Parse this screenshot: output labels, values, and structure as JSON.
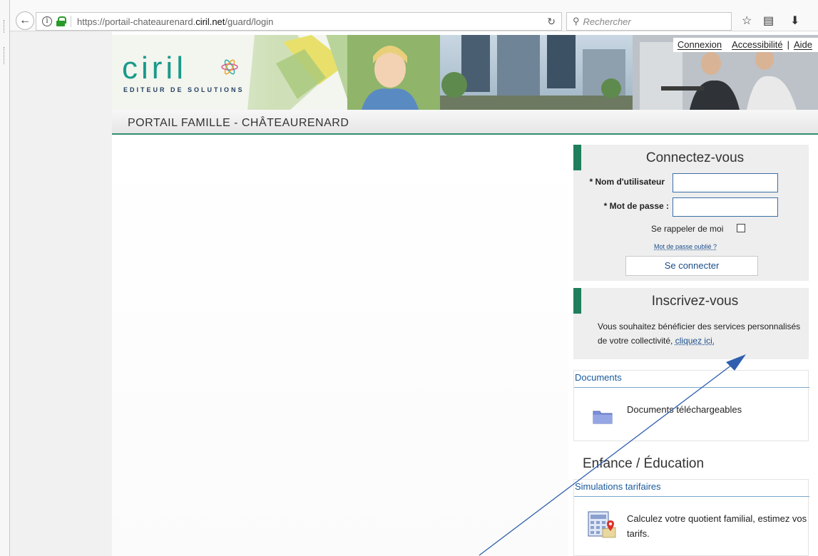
{
  "browser": {
    "url_prefix": "https://portail-chateaurenard.",
    "url_domain": "ciril.net",
    "url_suffix": "/guard/login",
    "search_placeholder": "Rechercher",
    "icons": [
      "back-arrow-icon",
      "info-icon",
      "lock-icon",
      "reload-icon",
      "search-icon",
      "star-icon",
      "reading-list-icon",
      "download-icon"
    ]
  },
  "header": {
    "logo_text": "ciril",
    "logo_subtitle": "EDITEUR DE SOLUTIONS",
    "links": {
      "connexion": "Connexion",
      "accessibilite": "Accessibilité",
      "aide": "Aide",
      "separator": "|"
    },
    "portal_title": "PORTAIL FAMILLE - CHÂTEAURENARD"
  },
  "login": {
    "title": "Connectez-vous",
    "username_label": "* Nom d'utilisateur",
    "password_label": "* Mot de passe :",
    "username_value": "",
    "password_value": "",
    "remember_label": "Se rappeler de moi",
    "remember_checked": false,
    "forgot_link": "Mot de passe oublié ?",
    "submit_label": "Se connecter"
  },
  "signup": {
    "title": "Inscrivez-vous",
    "text": "Vous souhaitez bénéficier des services personnalisés de votre collectivité,",
    "link": "cliquez ici."
  },
  "documents": {
    "header": "Documents",
    "item_label": "Documents téléchargeables"
  },
  "enfance": {
    "title": "Enfance / Éducation",
    "card_header": "Simulations tarifaires",
    "card_text": "Calculez votre quotient familial, estimez vos tarifs."
  },
  "colors": {
    "accent_green": "#1e7f5a",
    "link_blue": "#1a4e8a",
    "logo_teal": "#1a9a8a",
    "annotation_arrow": "#2f5fae"
  }
}
